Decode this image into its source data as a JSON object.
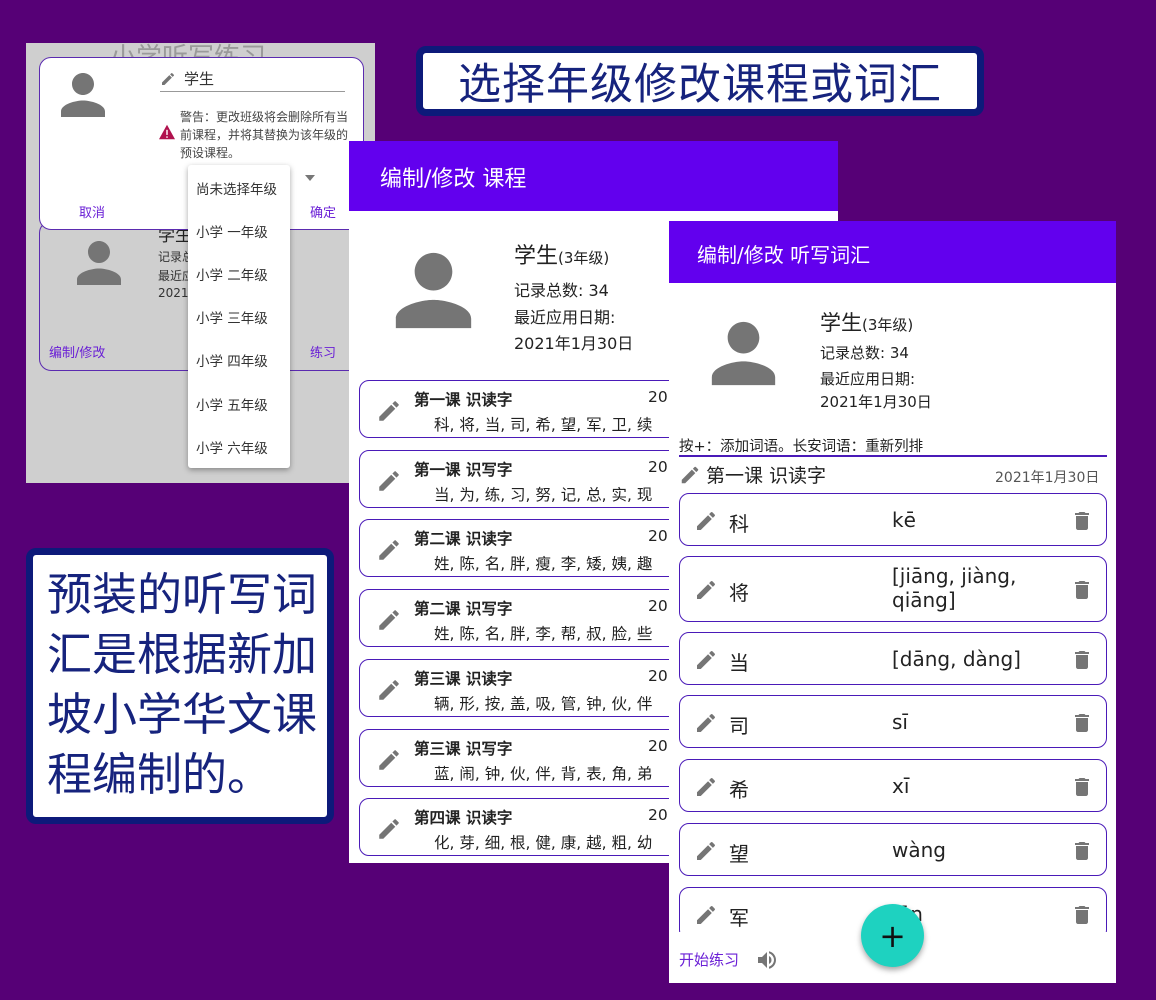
{
  "callouts": {
    "top": "选择年级修改课程或词汇",
    "left": "预装的听写词汇是根据新加坡小学华文课程编制的。"
  },
  "screen1": {
    "faded_title": "小学听写练习",
    "name_value": "学生",
    "warning": "警告：更改班级将会删除所有当前课程，并将其替换为该年级的预设课程。",
    "cancel_label": "取消",
    "ok_label": "确定",
    "card_name": "学生",
    "card_line1_fragment": "记录总",
    "card_line2_fragment": "最近应",
    "card_line3_fragment": "2021-",
    "edit_label": "编制/修改",
    "practice_label": "练习",
    "grade_options": [
      "尚未选择年级",
      "小学 一年级",
      "小学 二年级",
      "小学 三年级",
      "小学 四年级",
      "小学 五年级",
      "小学 六年级"
    ]
  },
  "screen2": {
    "header_title": "编制/修改 课程",
    "student_name": "学生",
    "grade": "(3年级)",
    "record_count": "记录总数: 34",
    "last_used_label": "最近应用日期:",
    "last_used_date": "2021年1月30日",
    "lessons": [
      {
        "title": "第一课 识读字",
        "date": "20",
        "chars": "科, 将, 当, 司, 希, 望, 军, 卫, 续"
      },
      {
        "title": "第一课 识写字",
        "date": "20",
        "chars": "当, 为, 练, 习, 努, 记, 总, 实, 现"
      },
      {
        "title": "第二课 识读字",
        "date": "20",
        "chars": "姓, 陈, 名, 胖, 瘦, 李, 矮, 姨, 趣"
      },
      {
        "title": "第二课 识写字",
        "date": "20",
        "chars": "姓, 陈, 名, 胖, 李, 帮, 叔, 脸, 些"
      },
      {
        "title": "第三课 识读字",
        "date": "20",
        "chars": "辆, 形, 按, 盖, 吸, 管, 钟, 伙, 伴"
      },
      {
        "title": "第三课 识写字",
        "date": "20",
        "chars": "蓝, 闹, 钟, 伙, 伴, 背, 表, 角, 弟"
      },
      {
        "title": "第四课 识读字",
        "date": "20",
        "chars": "化, 芽, 细, 根, 健, 康, 越, 粗, 幼"
      }
    ]
  },
  "screen3": {
    "header_title": "编制/修改 听写词汇",
    "student_name": "学生",
    "grade": "(3年级)",
    "record_count": "记录总数: 34",
    "last_used_label": "最近应用日期:",
    "last_used_date": "2021年1月30日",
    "hint": "按+：添加词语。长安词语：重新列排",
    "lesson_title": "第一课 识读字",
    "lesson_date": "2021年1月30日",
    "words": [
      {
        "char": "科",
        "pinyin": "kē"
      },
      {
        "char": "将",
        "pinyin": "[jiāng, jiàng, qiāng]"
      },
      {
        "char": "当",
        "pinyin": "[dāng, dàng]"
      },
      {
        "char": "司",
        "pinyin": "sī"
      },
      {
        "char": "希",
        "pinyin": "xī"
      },
      {
        "char": "望",
        "pinyin": "wàng"
      },
      {
        "char": "军",
        "pinyin": "jūn"
      }
    ],
    "start_practice_label": "开始练习",
    "fab_label": "+"
  },
  "colors": {
    "background": "#560076",
    "app_bar": "#6200ee",
    "accent_text": "#6a1fd6",
    "fab": "#1ed2c0",
    "callout_border": "#0d1a7a"
  }
}
